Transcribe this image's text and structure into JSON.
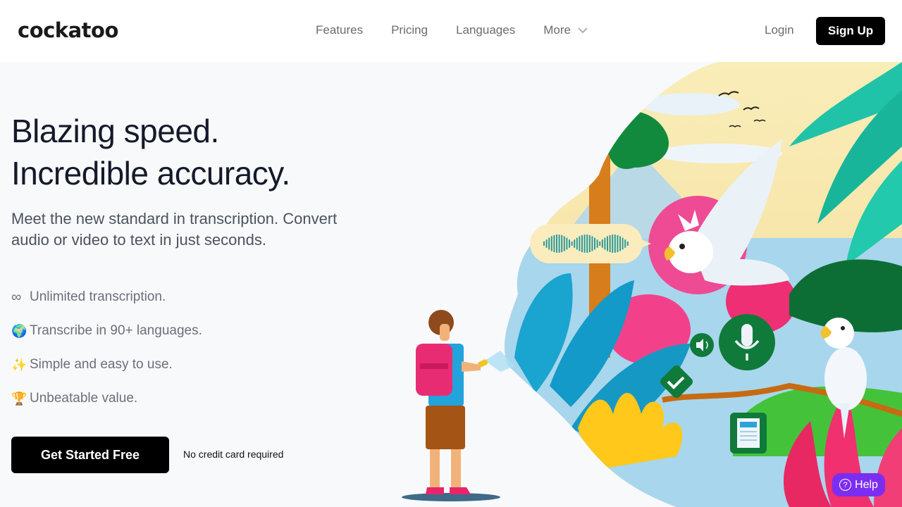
{
  "header": {
    "logo": "cockatoo",
    "nav": [
      {
        "label": "Features"
      },
      {
        "label": "Pricing"
      },
      {
        "label": "Languages"
      },
      {
        "label": "More",
        "icon": "chevron-down-icon"
      }
    ],
    "login_label": "Login",
    "signup_label": "Sign Up"
  },
  "hero": {
    "headline_line1": "Blazing speed.",
    "headline_line2": "Incredible accuracy.",
    "lead": "Meet the new standard in transcription. Convert audio or video to text in just seconds.",
    "features": [
      {
        "icon": "infinity-icon",
        "glyph": "∞",
        "label": "Unlimited transcription."
      },
      {
        "icon": "globe-icon",
        "glyph": "🌍",
        "label": "Transcribe in 90+ languages."
      },
      {
        "icon": "sparkles-icon",
        "glyph": "✨",
        "label": "Simple and easy to use."
      },
      {
        "icon": "trophy-icon",
        "glyph": "🏆",
        "label": "Unbeatable value."
      }
    ],
    "cta_label": "Get Started Free",
    "cta_note": "No credit card required"
  },
  "help": {
    "label": "Help",
    "icon": "question-circle-icon",
    "glyph": "?"
  },
  "colors": {
    "brand_dark": "#000000",
    "help_purple": "#7c2ef0",
    "page_bg": "#f8f9fb",
    "accent_green": "#0f7a3a",
    "accent_pink": "#f0306f",
    "accent_teal": "#1fbfa5"
  }
}
